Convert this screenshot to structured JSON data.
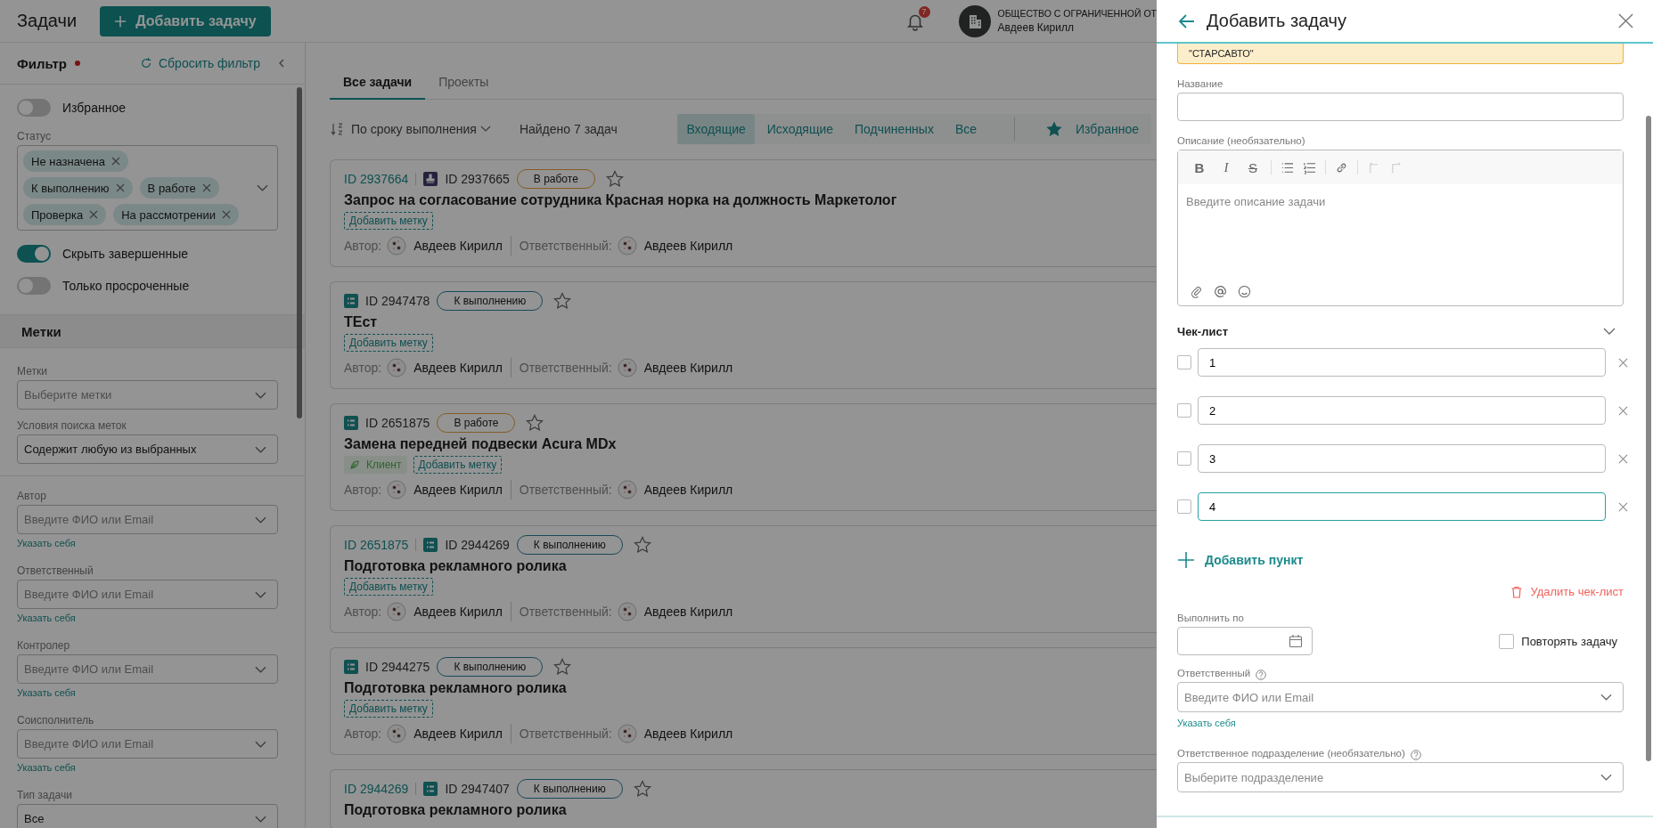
{
  "header": {
    "title": "Задачи",
    "add_button": "Добавить задачу",
    "notifications": "7",
    "company": "ОБЩЕСТВО С ОГРАНИЧЕННОЙ ОТ",
    "user": "Авдеев Кирилл"
  },
  "filter": {
    "title": "Фильтр",
    "modified": true,
    "reset": "Сбросить фильтр",
    "favorites": {
      "label": "Избранное",
      "on": false
    },
    "status": {
      "label": "Статус",
      "chips": [
        "Не назначена",
        "К выполнению",
        "В работе",
        "Проверка",
        "На рассмотрении"
      ]
    },
    "toggles": [
      {
        "label": "Скрыть завершенные",
        "on": true
      },
      {
        "label": "Только просроченные",
        "on": false
      }
    ],
    "tags_section": "Метки",
    "tag_fields": [
      {
        "label": "Метки",
        "placeholder": "Выберите метки"
      },
      {
        "label": "Условия поиска меток",
        "value": "Содержит любую из выбранных"
      }
    ],
    "people_fields": [
      {
        "label": "Автор",
        "placeholder": "Введите ФИО или Email",
        "link": "Указать себя"
      },
      {
        "label": "Ответственный",
        "placeholder": "Введите ФИО или Email",
        "link": "Указать себя"
      },
      {
        "label": "Контролер",
        "placeholder": "Введите ФИО или Email",
        "link": "Указать себя"
      },
      {
        "label": "Соисполнитель",
        "placeholder": "Введите ФИО или Email",
        "link": "Указать себя"
      }
    ],
    "type_field": {
      "label": "Тип задачи",
      "value": "Все"
    }
  },
  "tabs": [
    {
      "label": "Все задачи",
      "selected": true
    },
    {
      "label": "Проекты",
      "selected": false
    }
  ],
  "toolbar": {
    "sort": "По сроку выполнения",
    "found": "Найдено 7 задач",
    "segments": [
      {
        "label": "Входящие",
        "selected": true
      },
      {
        "label": "Исходящие",
        "selected": false
      },
      {
        "label": "Подчиненных",
        "selected": false
      },
      {
        "label": "Все",
        "selected": false
      }
    ],
    "favorites": "Избранное"
  },
  "cards": [
    {
      "parent_id": "ID 2937664",
      "kind": "approval",
      "id": "ID 2937665",
      "status": {
        "label": "В работе",
        "kind": "in_progress"
      },
      "starred": false,
      "title": "Запрос на согласование сотрудника Красная норка на должность Маркетолог",
      "add_tag": "Добавить метку",
      "author_label": "Автор:",
      "author": "Авдеев Кирилл",
      "assignee_label": "Ответственный:",
      "assignee": "Авдеев Кирилл"
    },
    {
      "kind": "task",
      "id": "ID 2947478",
      "status": {
        "label": "К выполнению",
        "kind": "todo"
      },
      "starred": false,
      "title": "ТЕст",
      "add_tag": "Добавить метку",
      "author_label": "Автор:",
      "author": "Авдеев Кирилл",
      "assignee_label": "Ответственный:",
      "assignee": "Авдеев Кирилл"
    },
    {
      "kind": "task",
      "id": "ID 2651875",
      "status": {
        "label": "В работе",
        "kind": "in_progress"
      },
      "starred": false,
      "title": "Замена передней подвески Acura MDx",
      "tags": [
        {
          "label": "Клиент"
        }
      ],
      "add_tag": "Добавить метку",
      "author_label": "Автор:",
      "author": "Авдеев Кирилл",
      "assignee_label": "Ответственный:",
      "assignee": "Авдеев Кирилл"
    },
    {
      "parent_id": "ID 2651875",
      "kind": "task",
      "id": "ID 2944269",
      "status": {
        "label": "К выполнению",
        "kind": "todo"
      },
      "starred": false,
      "title": "Подготовка рекламного ролика",
      "add_tag": "Добавить метку",
      "author_label": "Автор:",
      "author": "Авдеев Кирилл",
      "assignee_label": "Ответственный:",
      "assignee": "Авдеев Кирилл"
    },
    {
      "kind": "task",
      "id": "ID 2944275",
      "status": {
        "label": "К выполнению",
        "kind": "todo"
      },
      "starred": false,
      "title": "Подготовка рекламного ролика",
      "add_tag": "Добавить метку",
      "author_label": "Автор:",
      "author": "Авдеев Кирилл",
      "assignee_label": "Ответственный:",
      "assignee": "Авдеев Кирилл"
    },
    {
      "parent_id": "ID 2944269",
      "kind": "task",
      "id": "ID 2947407",
      "status": {
        "label": "К выполнению",
        "kind": "todo"
      },
      "starred": false,
      "title": "Подготовка рекламного ролика"
    }
  ],
  "drawer": {
    "title": "Добавить задачу",
    "banner": "\"СТАРСАВТО\"",
    "name_label": "Название",
    "desc_label": "Описание (необязательно)",
    "desc_placeholder": "Введите описание задачи",
    "format_buttons": [
      {
        "label": "B",
        "kind": "bold"
      },
      {
        "label": "I",
        "kind": "italic"
      },
      {
        "label": "S",
        "kind": "strike"
      }
    ],
    "checklist": {
      "title": "Чек-лист",
      "expanded": true,
      "items": [
        {
          "value": "1",
          "checked": false,
          "focused": false
        },
        {
          "value": "2",
          "checked": false,
          "focused": false
        },
        {
          "value": "3",
          "checked": false,
          "focused": false
        },
        {
          "value": "4",
          "checked": false,
          "focused": true
        }
      ],
      "add": "Добавить пункт",
      "delete": "Удалить чек-лист"
    },
    "due_label": "Выполнить по",
    "repeat": {
      "label": "Повторять задачу",
      "checked": false
    },
    "assignee": {
      "label": "Ответственный",
      "placeholder": "Введите ФИО или Email",
      "link": "Указать себя"
    },
    "department": {
      "label": "Ответственное подразделение (необязательно)",
      "placeholder": "Выберите подразделение"
    }
  }
}
